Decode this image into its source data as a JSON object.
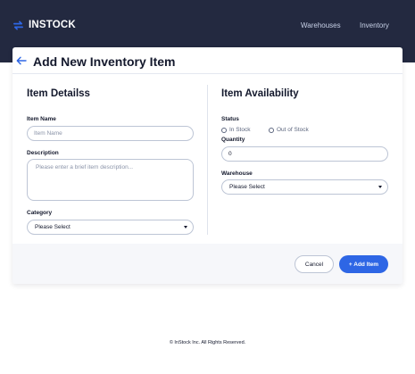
{
  "topbar": {
    "logo_text": "INSTOCK",
    "logo_icon": "swap-arrows-icon",
    "nav": [
      {
        "label": "Warehouses"
      },
      {
        "label": "Inventory"
      }
    ]
  },
  "page": {
    "title": "Add New Inventory Item",
    "back_icon": "arrow-left-icon"
  },
  "details": {
    "title": "Item Detailss",
    "item_name_label": "Item Name",
    "item_name_placeholder": "Item Name",
    "item_name_value": "",
    "description_label": "Description",
    "description_placeholder": "Please enter a brief item description...",
    "description_value": "",
    "category_label": "Category",
    "category_value": "Please Select"
  },
  "availability": {
    "title": "Item Availability",
    "status_label": "Status",
    "status_options": [
      {
        "label": "In Stock",
        "selected": false
      },
      {
        "label": "Out of Stock",
        "selected": false
      }
    ],
    "quantity_label": "Quantity",
    "quantity_value": "0",
    "warehouse_label": "Warehouse",
    "warehouse_value": "Please Select"
  },
  "actions": {
    "cancel_label": "Cancel",
    "add_label": "+ Add Item"
  },
  "colors": {
    "header_bg": "#232940",
    "accent": "#2e66e5",
    "footer_bg": "#f6f7fa",
    "text": "#13182c"
  },
  "footer": {
    "copyright": "© InStock Inc. All Rights Reserved."
  }
}
